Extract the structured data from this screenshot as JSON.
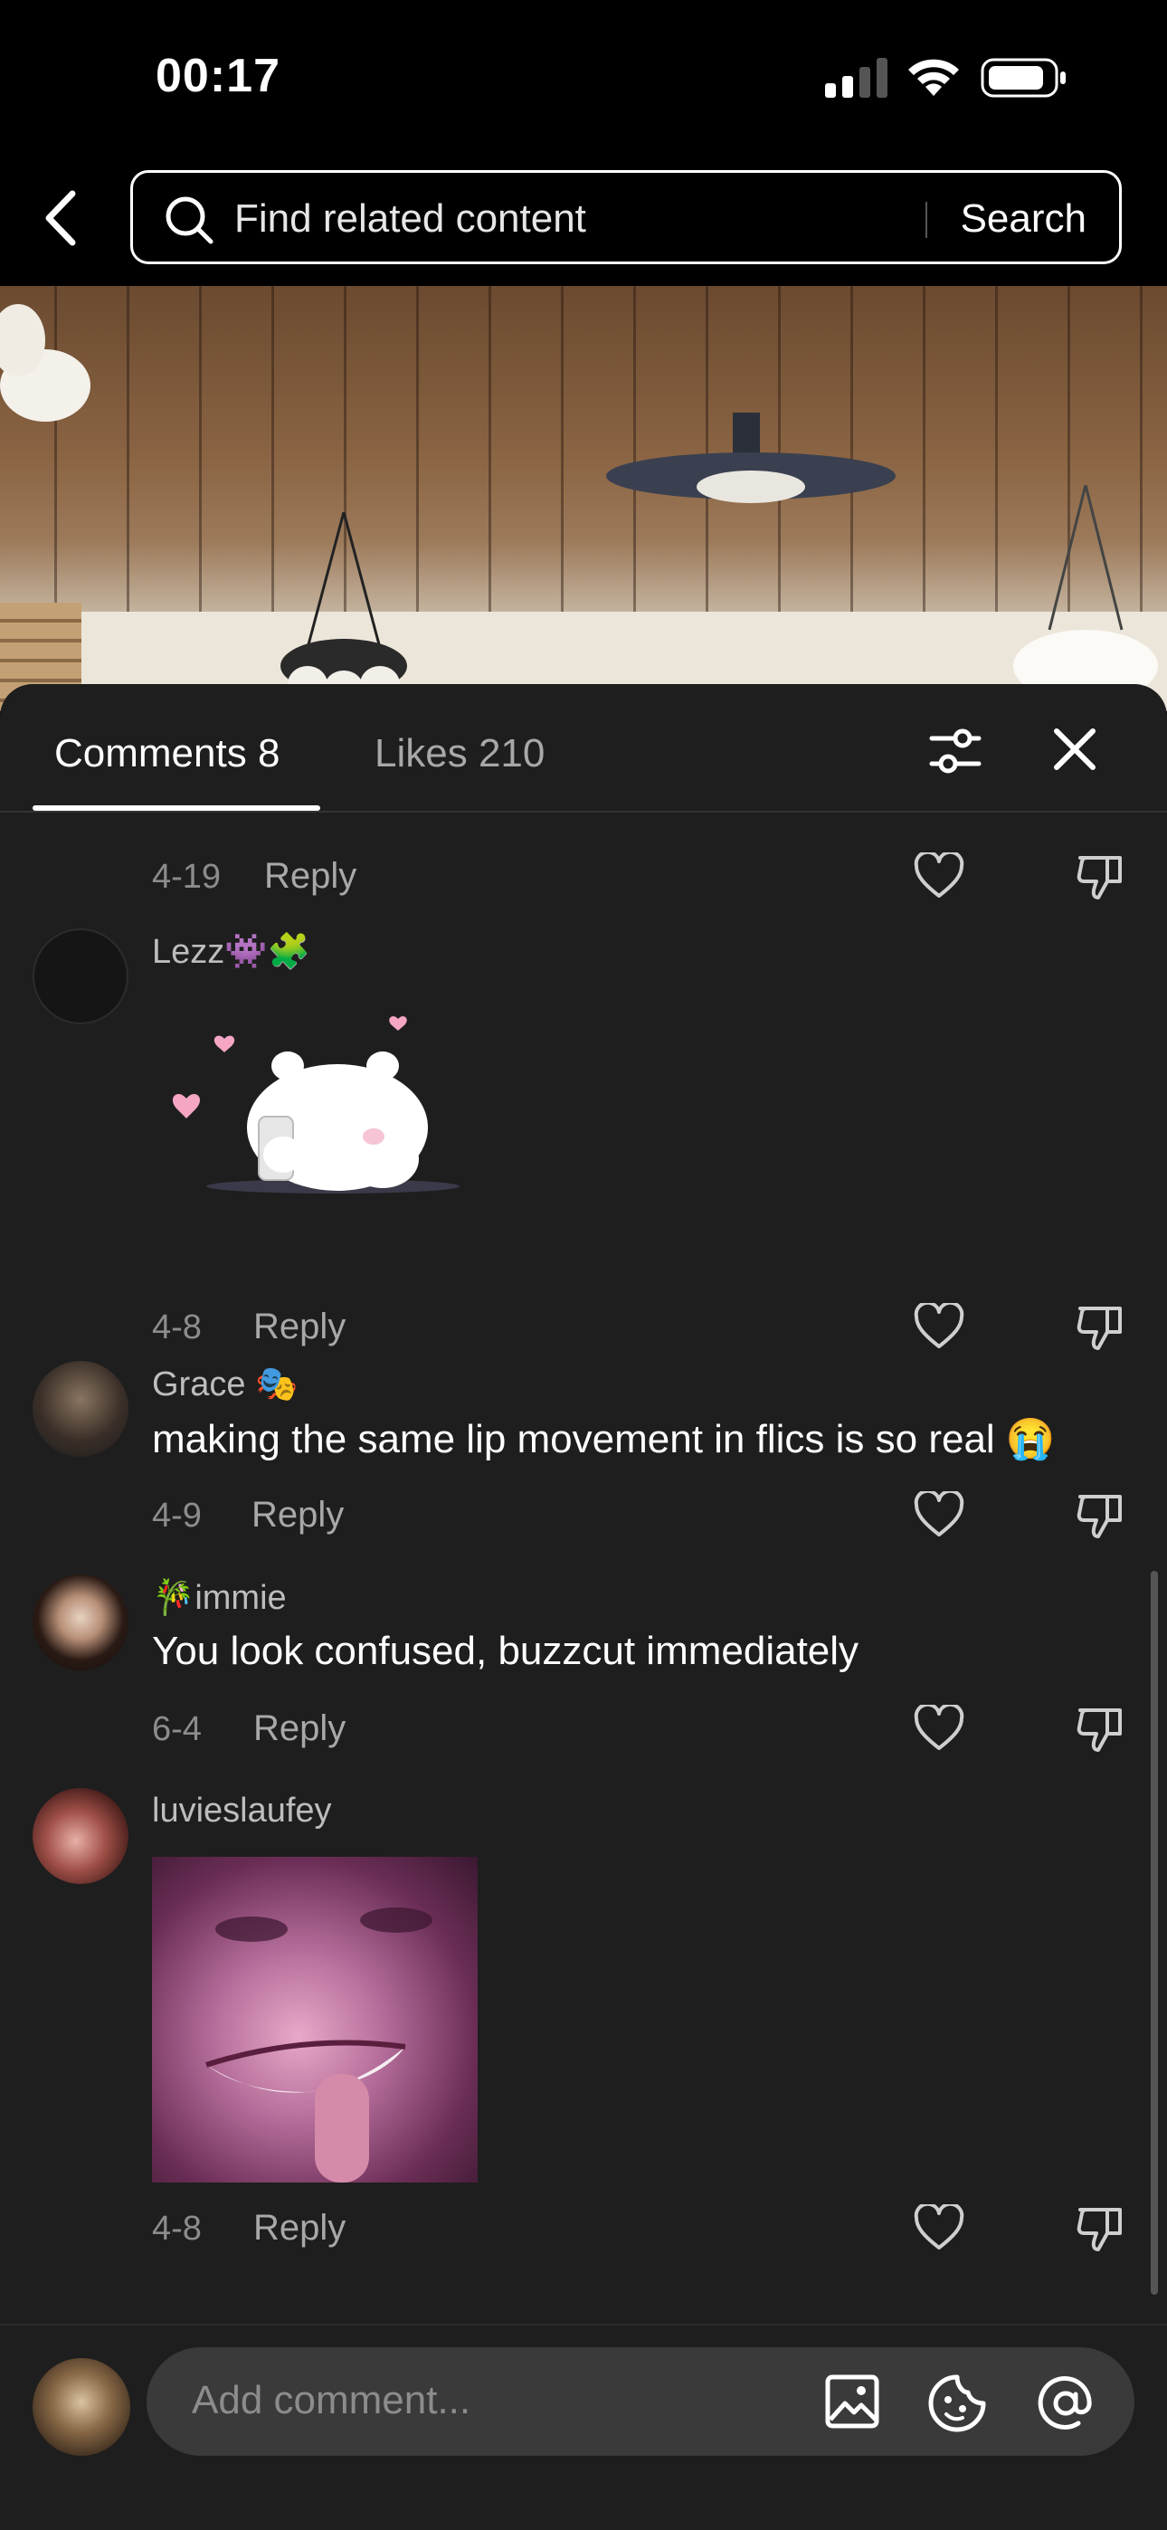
{
  "status_bar": {
    "time": "00:17"
  },
  "search": {
    "placeholder": "Find related content",
    "button_label": "Search"
  },
  "tabs": [
    {
      "label": "Comments 8",
      "active": true
    },
    {
      "label": "Likes 210",
      "active": false
    }
  ],
  "comments": [
    {
      "date": "4-19",
      "reply_label": "Reply"
    },
    {
      "username": "Lezz👾🧩",
      "date": "4-8",
      "reply_label": "Reply",
      "attachment": "sticker"
    },
    {
      "username": "Grace 🎭",
      "text": "making the same lip movement in flics is so real 😭",
      "date": "4-9",
      "reply_label": "Reply"
    },
    {
      "username": "🎋immie",
      "text": "You look confused, buzzcut immediately",
      "date": "6-4",
      "reply_label": "Reply"
    },
    {
      "username": "luvieslaufey",
      "date": "4-8",
      "reply_label": "Reply",
      "attachment": "photo"
    }
  ],
  "composer": {
    "placeholder": "Add comment..."
  },
  "icons": [
    "back-arrow-icon",
    "search-icon",
    "filter-icon",
    "close-icon",
    "heart-icon",
    "dislike-icon",
    "image-icon",
    "sticker-icon",
    "mention-icon"
  ],
  "colors": {
    "sheet_bg": "#1e1e1e",
    "muted_text": "#8c8c8c",
    "input_bg": "#3a3a3a"
  }
}
